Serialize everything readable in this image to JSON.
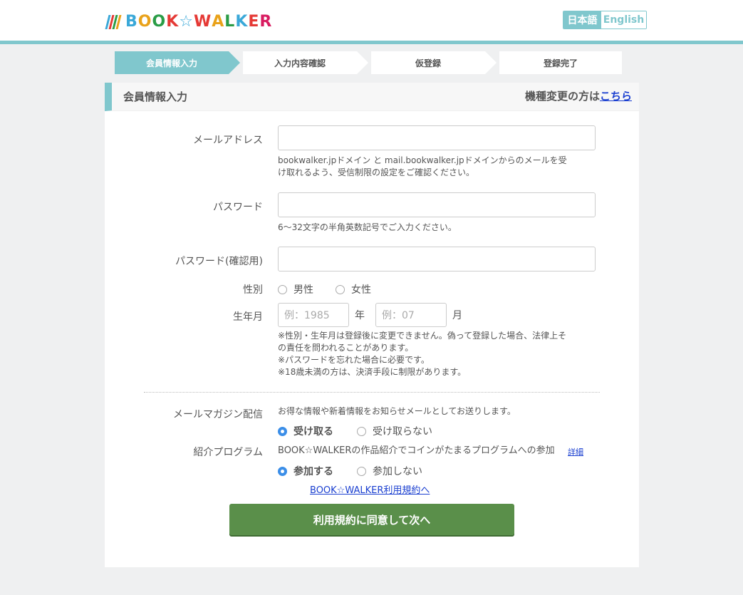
{
  "header": {
    "logo_text": [
      "B",
      "O",
      "O",
      "K",
      "☆",
      "W",
      "A",
      "L",
      "K",
      "E",
      "R"
    ],
    "logo_colors": [
      "#3aa8d8",
      "#e9a21a",
      "#2a9c46",
      "#e53935",
      "#3aa8d8",
      "#e53935",
      "#e9a21a",
      "#2a9c46",
      "#3aa8d8",
      "#e53935",
      "#d81b60"
    ],
    "logo_mark_colors": [
      "#3aa8d8",
      "#e53935",
      "#2a9c46",
      "#e9a21a"
    ],
    "lang_ja": "日本語",
    "lang_en": "English"
  },
  "steps": [
    "会員情報入力",
    "入力内容確認",
    "仮登録",
    "登録完了"
  ],
  "panel": {
    "title": "会員情報入力",
    "device_change_prefix": "機種変更の方は",
    "device_change_link": "こちら"
  },
  "form": {
    "email_label": "メールアドレス",
    "email_note_1": "bookwalker.jpドメイン と mail.bookwalker.jpドメインからのメールを受",
    "email_note_2": "け取れるよう、受信制限の設定をご確認ください。",
    "password_label": "パスワード",
    "password_note": "6〜32文字の半角英数記号でご入力ください。",
    "password_confirm_label": "パスワード(確認用)",
    "gender_label": "性別",
    "gender_male": "男性",
    "gender_female": "女性",
    "birth_label": "生年月",
    "birth_year_placeholder": "例：1985",
    "birth_year_unit": "年",
    "birth_month_placeholder": "例：07",
    "birth_month_unit": "月",
    "notes": [
      "※性別・生年月は登録後に変更できません。偽って登録した場合、法律上そ",
      "の責任を問われることがあります。",
      "※パスワードを忘れた場合に必要です。",
      "※18歳未満の方は、決済手段に制限があります。"
    ],
    "magazine_label": "メールマガジン配信",
    "magazine_desc": "お得な情報や新着情報をお知らせメールとしてお送りします。",
    "magazine_yes": "受け取る",
    "magazine_no": "受け取らない",
    "referral_label": "紹介プログラム",
    "referral_desc": "BOOK☆WALKERの作品紹介でコインがたまるプログラムへの参加",
    "referral_detail": "詳細",
    "referral_yes": "参加する",
    "referral_no": "参加しない",
    "terms_link": "BOOK☆WALKER利用規約へ",
    "submit": "利用規約に同意して次へ"
  }
}
